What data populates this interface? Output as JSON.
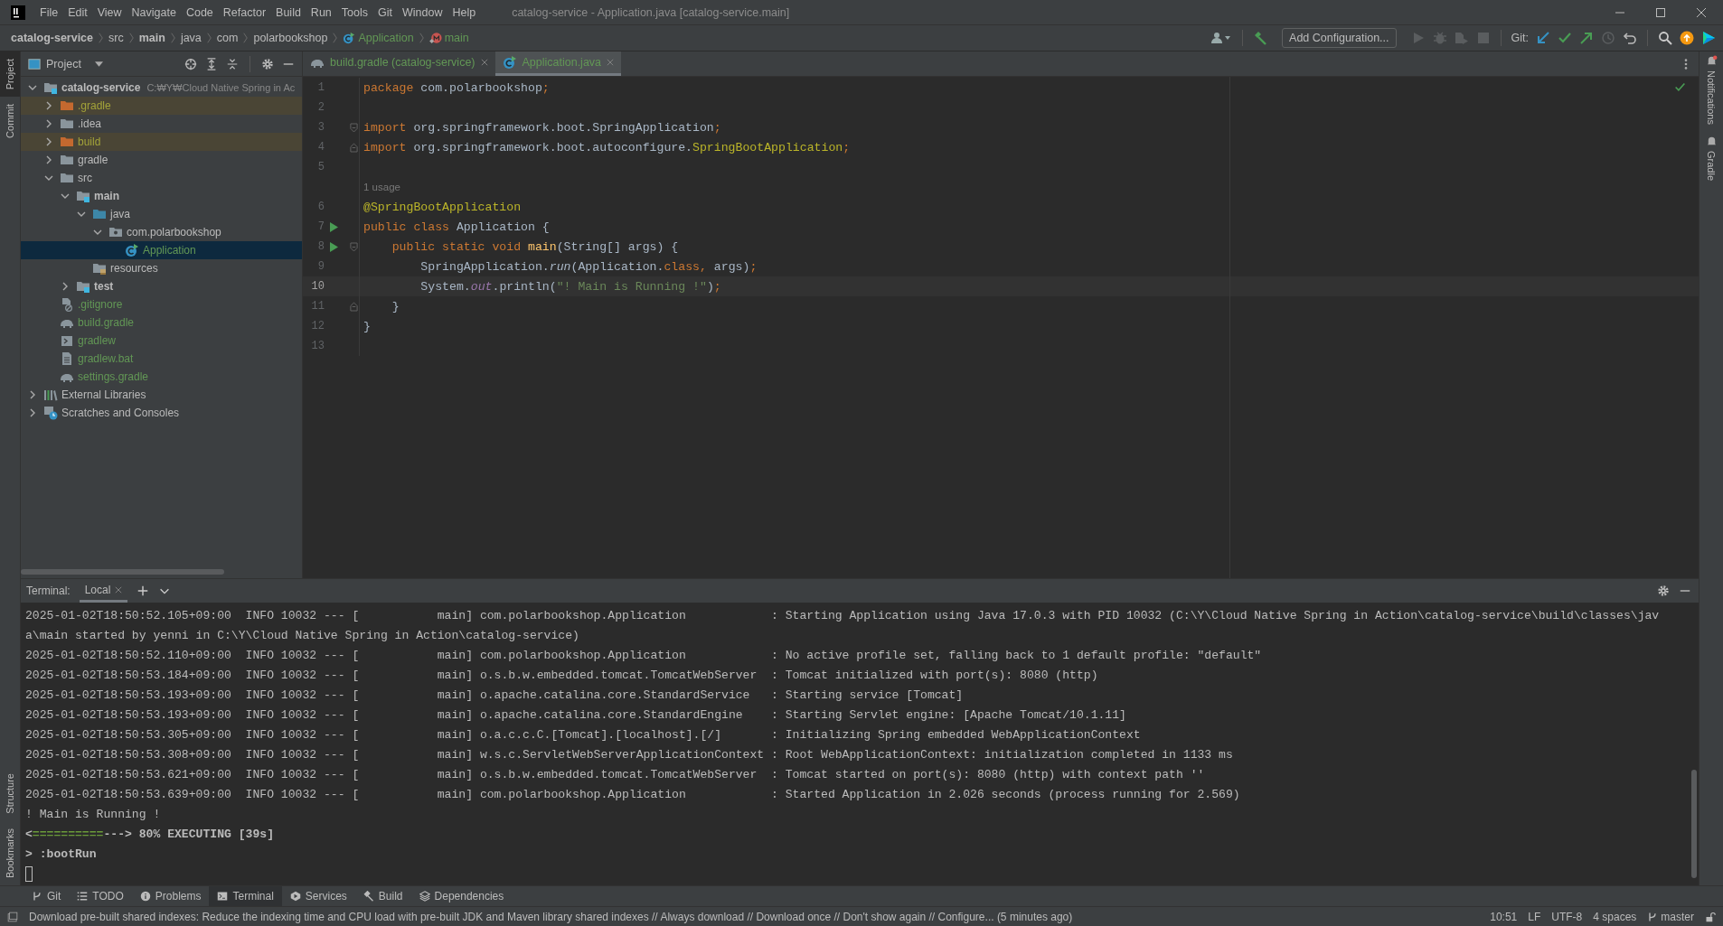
{
  "window": {
    "title": "catalog-service - Application.java [catalog-service.main]",
    "menu": [
      "File",
      "Edit",
      "View",
      "Navigate",
      "Code",
      "Refactor",
      "Build",
      "Run",
      "Tools",
      "Git",
      "Window",
      "Help"
    ]
  },
  "navigation": {
    "breadcrumbs": [
      {
        "label": "catalog-service",
        "bold": true
      },
      {
        "label": "src",
        "bold": false
      },
      {
        "label": "main",
        "bold": true
      },
      {
        "label": "java",
        "bold": false
      },
      {
        "label": "com",
        "bold": false
      },
      {
        "label": "polarbookshop",
        "bold": false
      },
      {
        "label": "Application",
        "bold": false,
        "kind": "class"
      },
      {
        "label": "main",
        "bold": false,
        "kind": "method"
      }
    ],
    "toolbar": {
      "config_button": "Add Configuration...",
      "run_disabled": true,
      "git_label": "Git:"
    }
  },
  "left_stripe": {
    "top": [
      {
        "label": "Project",
        "selected": true
      },
      {
        "label": "Commit",
        "selected": false
      }
    ],
    "bottom": [
      {
        "label": "Structure",
        "selected": false
      },
      {
        "label": "Bookmarks",
        "selected": false
      }
    ]
  },
  "right_stripe": [
    {
      "label": "Notifications",
      "badge": true
    },
    {
      "label": "Gradle",
      "badge": false
    }
  ],
  "project_panel": {
    "title": "Project",
    "tree": [
      {
        "label": "catalog-service",
        "kind": "module",
        "added": false,
        "excluded": false,
        "bold": true,
        "hint": "C:₩Y₩Cloud Native Spring in Ac",
        "expanded": true,
        "selected": false,
        "children": [
          {
            "label": ".gradle",
            "kind": "folder",
            "added": false,
            "excluded": true,
            "expanded": false,
            "selected": false
          },
          {
            "label": ".idea",
            "kind": "folder",
            "added": false,
            "excluded": false,
            "expanded": false,
            "selected": false
          },
          {
            "label": "build",
            "kind": "folder",
            "added": false,
            "excluded": true,
            "expanded": false,
            "selected": false
          },
          {
            "label": "gradle",
            "kind": "folder",
            "added": false,
            "excluded": false,
            "expanded": false,
            "selected": false
          },
          {
            "label": "src",
            "kind": "folder",
            "added": false,
            "excluded": false,
            "expanded": true,
            "selected": false,
            "children": [
              {
                "label": "main",
                "kind": "source-set",
                "added": false,
                "excluded": false,
                "bold": true,
                "expanded": true,
                "selected": false,
                "children": [
                  {
                    "label": "java",
                    "kind": "source-root",
                    "added": false,
                    "excluded": false,
                    "expanded": true,
                    "selected": false,
                    "children": [
                      {
                        "label": "com.polarbookshop",
                        "kind": "package",
                        "added": false,
                        "excluded": false,
                        "expanded": true,
                        "selected": false,
                        "children": [
                          {
                            "label": "Application",
                            "kind": "java-class",
                            "added": true,
                            "excluded": false,
                            "selected": true
                          }
                        ]
                      }
                    ]
                  },
                  {
                    "label": "resources",
                    "kind": "resources-root",
                    "added": false,
                    "excluded": false,
                    "selected": false
                  }
                ]
              },
              {
                "label": "test",
                "kind": "source-set",
                "added": false,
                "excluded": false,
                "bold": true,
                "expanded": false,
                "selected": false
              }
            ]
          },
          {
            "label": ".gitignore",
            "kind": "ignore-file",
            "added": true,
            "excluded": false,
            "selected": false
          },
          {
            "label": "build.gradle",
            "kind": "gradle-file",
            "added": true,
            "excluded": false,
            "selected": false
          },
          {
            "label": "gradlew",
            "kind": "script-file",
            "added": true,
            "excluded": false,
            "selected": false
          },
          {
            "label": "gradlew.bat",
            "kind": "text-file",
            "added": true,
            "excluded": false,
            "selected": false
          },
          {
            "label": "settings.gradle",
            "kind": "gradle-file",
            "added": true,
            "excluded": false,
            "selected": false
          }
        ]
      },
      {
        "label": "External Libraries",
        "kind": "libraries",
        "added": false,
        "excluded": false,
        "expanded": false,
        "selected": false
      },
      {
        "label": "Scratches and Consoles",
        "kind": "scratches",
        "added": false,
        "excluded": false,
        "expanded": false,
        "selected": false
      }
    ]
  },
  "editor": {
    "tabs": [
      {
        "label": "build.gradle (catalog-service)",
        "kind": "gradle-file",
        "added": true,
        "selected": false
      },
      {
        "label": "Application.java",
        "kind": "java-class",
        "added": true,
        "selected": true
      }
    ],
    "lines": [
      {
        "kind": "code",
        "number": "1",
        "current": false,
        "tokens": [
          {
            "text": "package",
            "kind": "keyword"
          },
          {
            "text": " com.polarbookshop",
            "kind": "plain"
          },
          {
            "text": ";",
            "kind": "keyword"
          }
        ]
      },
      {
        "kind": "code",
        "number": "2",
        "current": false
      },
      {
        "kind": "code",
        "number": "3",
        "current": false,
        "fold_start": true,
        "tokens": [
          {
            "text": "import",
            "kind": "keyword"
          },
          {
            "text": " org.springframework.boot.SpringApplication",
            "kind": "plain"
          },
          {
            "text": ";",
            "kind": "keyword"
          }
        ]
      },
      {
        "kind": "code",
        "number": "4",
        "current": false,
        "fold_end": true,
        "tokens": [
          {
            "text": "import",
            "kind": "keyword"
          },
          {
            "text": " org.springframework.boot.autoconfigure.",
            "kind": "plain"
          },
          {
            "text": "SpringBootApplication",
            "kind": "annotation"
          },
          {
            "text": ";",
            "kind": "keyword"
          }
        ]
      },
      {
        "kind": "code",
        "number": "5",
        "current": false
      },
      {
        "kind": "hint",
        "text": "1 usage"
      },
      {
        "kind": "code",
        "number": "6",
        "current": false,
        "tokens": [
          {
            "text": "@SpringBootApplication",
            "kind": "annotation"
          }
        ]
      },
      {
        "kind": "code",
        "number": "7",
        "run": true,
        "current": false,
        "tokens": [
          {
            "text": "public class",
            "kind": "keyword"
          },
          {
            "text": " Application {",
            "kind": "plain"
          }
        ]
      },
      {
        "kind": "code",
        "number": "8",
        "run": true,
        "current": false,
        "fold_start": true,
        "tokens": [
          {
            "text": "    public static void ",
            "kind": "keyword"
          },
          {
            "text": "main",
            "kind": "method"
          },
          {
            "text": "(String[] args) {",
            "kind": "plain"
          }
        ]
      },
      {
        "kind": "code",
        "number": "9",
        "current": false,
        "tokens": [
          {
            "text": "        SpringApplication.",
            "kind": "plain"
          },
          {
            "text": "run",
            "kind": "static-method"
          },
          {
            "text": "(Application.",
            "kind": "plain"
          },
          {
            "text": "class",
            "kind": "keyword"
          },
          {
            "text": ",",
            "kind": "keyword"
          },
          {
            "text": " args)",
            "kind": "plain"
          },
          {
            "text": ";",
            "kind": "keyword"
          }
        ]
      },
      {
        "kind": "code",
        "number": "10",
        "current": true,
        "tokens": [
          {
            "text": "        System.",
            "kind": "plain"
          },
          {
            "text": "out",
            "kind": "static-field"
          },
          {
            "text": ".println(",
            "kind": "plain"
          },
          {
            "text": "\"! Main is Running !\"",
            "kind": "string"
          },
          {
            "text": ")",
            "kind": "plain"
          },
          {
            "text": ";",
            "kind": "keyword"
          }
        ]
      },
      {
        "kind": "code",
        "number": "11",
        "current": false,
        "fold_end": true,
        "tokens": [
          {
            "text": "    }",
            "kind": "plain"
          }
        ]
      },
      {
        "kind": "code",
        "number": "12",
        "current": false,
        "tokens": [
          {
            "text": "}",
            "kind": "plain"
          }
        ]
      },
      {
        "kind": "code",
        "number": "13",
        "current": false
      }
    ]
  },
  "terminal": {
    "label": "Terminal:",
    "tabs": [
      {
        "label": "Local",
        "selected": true
      }
    ],
    "lines": [
      {
        "kind": "log",
        "text": "2025-01-02T18:50:52.105+09:00  INFO 10032 --- [           main] com.polarbookshop.Application            : Starting Application using Java 17.0.3 with PID 10032 (C:\\Y\\Cloud Native Spring in Action\\catalog-service\\build\\classes\\jav"
      },
      {
        "kind": "log",
        "text": "a\\main started by yenni in C:\\Y\\Cloud Native Spring in Action\\catalog-service)"
      },
      {
        "kind": "log",
        "text": "2025-01-02T18:50:52.110+09:00  INFO 10032 --- [           main] com.polarbookshop.Application            : No active profile set, falling back to 1 default profile: \"default\""
      },
      {
        "kind": "log",
        "text": "2025-01-02T18:50:53.184+09:00  INFO 10032 --- [           main] o.s.b.w.embedded.tomcat.TomcatWebServer  : Tomcat initialized with port(s): 8080 (http)"
      },
      {
        "kind": "log",
        "text": "2025-01-02T18:50:53.193+09:00  INFO 10032 --- [           main] o.apache.catalina.core.StandardService   : Starting service [Tomcat]"
      },
      {
        "kind": "log",
        "text": "2025-01-02T18:50:53.193+09:00  INFO 10032 --- [           main] o.apache.catalina.core.StandardEngine    : Starting Servlet engine: [Apache Tomcat/10.1.11]"
      },
      {
        "kind": "log",
        "text": "2025-01-02T18:50:53.305+09:00  INFO 10032 --- [           main] o.a.c.c.C.[Tomcat].[localhost].[/]       : Initializing Spring embedded WebApplicationContext"
      },
      {
        "kind": "log",
        "text": "2025-01-02T18:50:53.308+09:00  INFO 10032 --- [           main] w.s.c.ServletWebServerApplicationContext : Root WebApplicationContext: initialization completed in 1133 ms"
      },
      {
        "kind": "log",
        "text": "2025-01-02T18:50:53.621+09:00  INFO 10032 --- [           main] o.s.b.w.embedded.tomcat.TomcatWebServer  : Tomcat started on port(s): 8080 (http) with context path ''"
      },
      {
        "kind": "log",
        "text": "2025-01-02T18:50:53.639+09:00  INFO 10032 --- [           main] com.polarbookshop.Application            : Started Application in 2.026 seconds (process running for 2.569)"
      },
      {
        "kind": "log",
        "text": "! Main is Running !"
      },
      {
        "kind": "progress",
        "segments": [
          {
            "text": "<",
            "kind": "plain"
          },
          {
            "text": "==========",
            "kind": "done"
          },
          {
            "text": "---> 80% EXECUTING [39s]",
            "kind": "plain"
          }
        ]
      },
      {
        "kind": "command",
        "text": "> :bootRun"
      },
      {
        "kind": "prompt"
      }
    ]
  },
  "tool_tabs": [
    {
      "label": "Git",
      "selected": false
    },
    {
      "label": "TODO",
      "selected": false
    },
    {
      "label": "Problems",
      "selected": false
    },
    {
      "label": "Terminal",
      "selected": true
    },
    {
      "label": "Services",
      "selected": false
    },
    {
      "label": "Build",
      "selected": false
    },
    {
      "label": "Dependencies",
      "selected": false
    }
  ],
  "status_bar": {
    "message": "Download pre-built shared indexes: Reduce the indexing time and CPU load with pre-built JDK and Maven library shared indexes // Always download // Download once // Don't show again // Configure... (5 minutes ago)",
    "items": [
      "10:51",
      "LF",
      "UTF-8",
      "4 spaces"
    ],
    "branch": "master"
  }
}
